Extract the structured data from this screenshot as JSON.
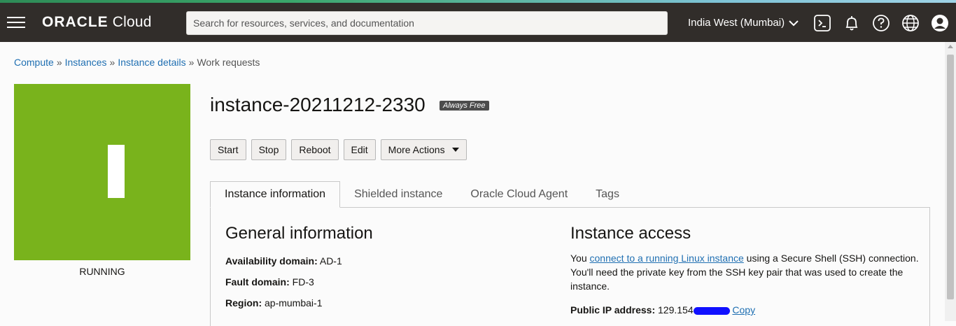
{
  "header": {
    "brand_bold": "ORACLE",
    "brand_light": "Cloud",
    "search_placeholder": "Search for resources, services, and documentation",
    "region": "India West (Mumbai)",
    "icons": [
      "menu-icon",
      "cloud-shell-icon",
      "bell-icon",
      "help-icon",
      "globe-icon",
      "user-icon"
    ]
  },
  "breadcrumb": {
    "items": [
      "Compute",
      "Instances",
      "Instance details"
    ],
    "current": "Work requests",
    "separator": "»"
  },
  "instance": {
    "letter": "I",
    "status": "RUNNING",
    "status_color": "#79b31c",
    "name": "instance-20211212-2330",
    "badge": "Always Free"
  },
  "actions": {
    "start": "Start",
    "stop": "Stop",
    "reboot": "Reboot",
    "edit": "Edit",
    "more": "More Actions"
  },
  "tabs": [
    "Instance information",
    "Shielded instance",
    "Oracle Cloud Agent",
    "Tags"
  ],
  "general": {
    "heading": "General information",
    "fields": [
      {
        "label": "Availability domain:",
        "value": "AD-1"
      },
      {
        "label": "Fault domain:",
        "value": "FD-3"
      },
      {
        "label": "Region:",
        "value": "ap-mumbai-1"
      }
    ]
  },
  "access": {
    "heading": "Instance access",
    "text_pre": "You ",
    "link": "connect to a running Linux instance",
    "text_post": " using a Secure Shell (SSH) connection. You'll need the private key from the SSH key pair that was used to create the instance.",
    "ip_label": "Public IP address:",
    "ip_value": "129.154.",
    "copy": "Copy"
  }
}
